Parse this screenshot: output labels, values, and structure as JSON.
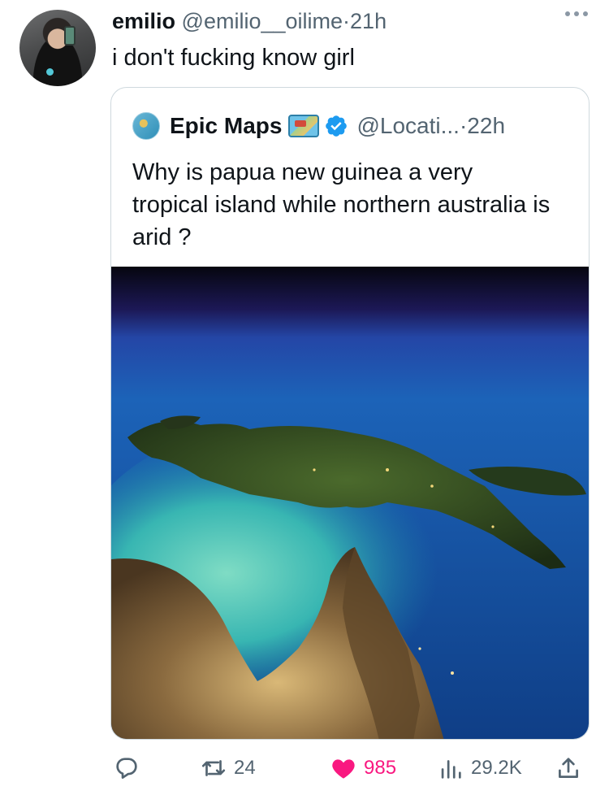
{
  "tweet": {
    "author_name": "emilio",
    "author_handle": "@emilio__oilime",
    "separator": "·",
    "time": "21h",
    "text": "i don't fucking know girl"
  },
  "quote": {
    "author_name": "Epic Maps",
    "author_handle": "@Locati...",
    "separator": "·",
    "time": "22h",
    "text": "Why is papua new guinea a very tropical island while northern australia is arid ?"
  },
  "actions": {
    "reply_icon": "reply-icon",
    "retweets": "24",
    "likes": "985",
    "views": "29.2K",
    "like_color": "#f91880"
  },
  "colors": {
    "secondary_text": "#536471",
    "verified": "#1d9bf0",
    "border": "#cfd9de"
  }
}
